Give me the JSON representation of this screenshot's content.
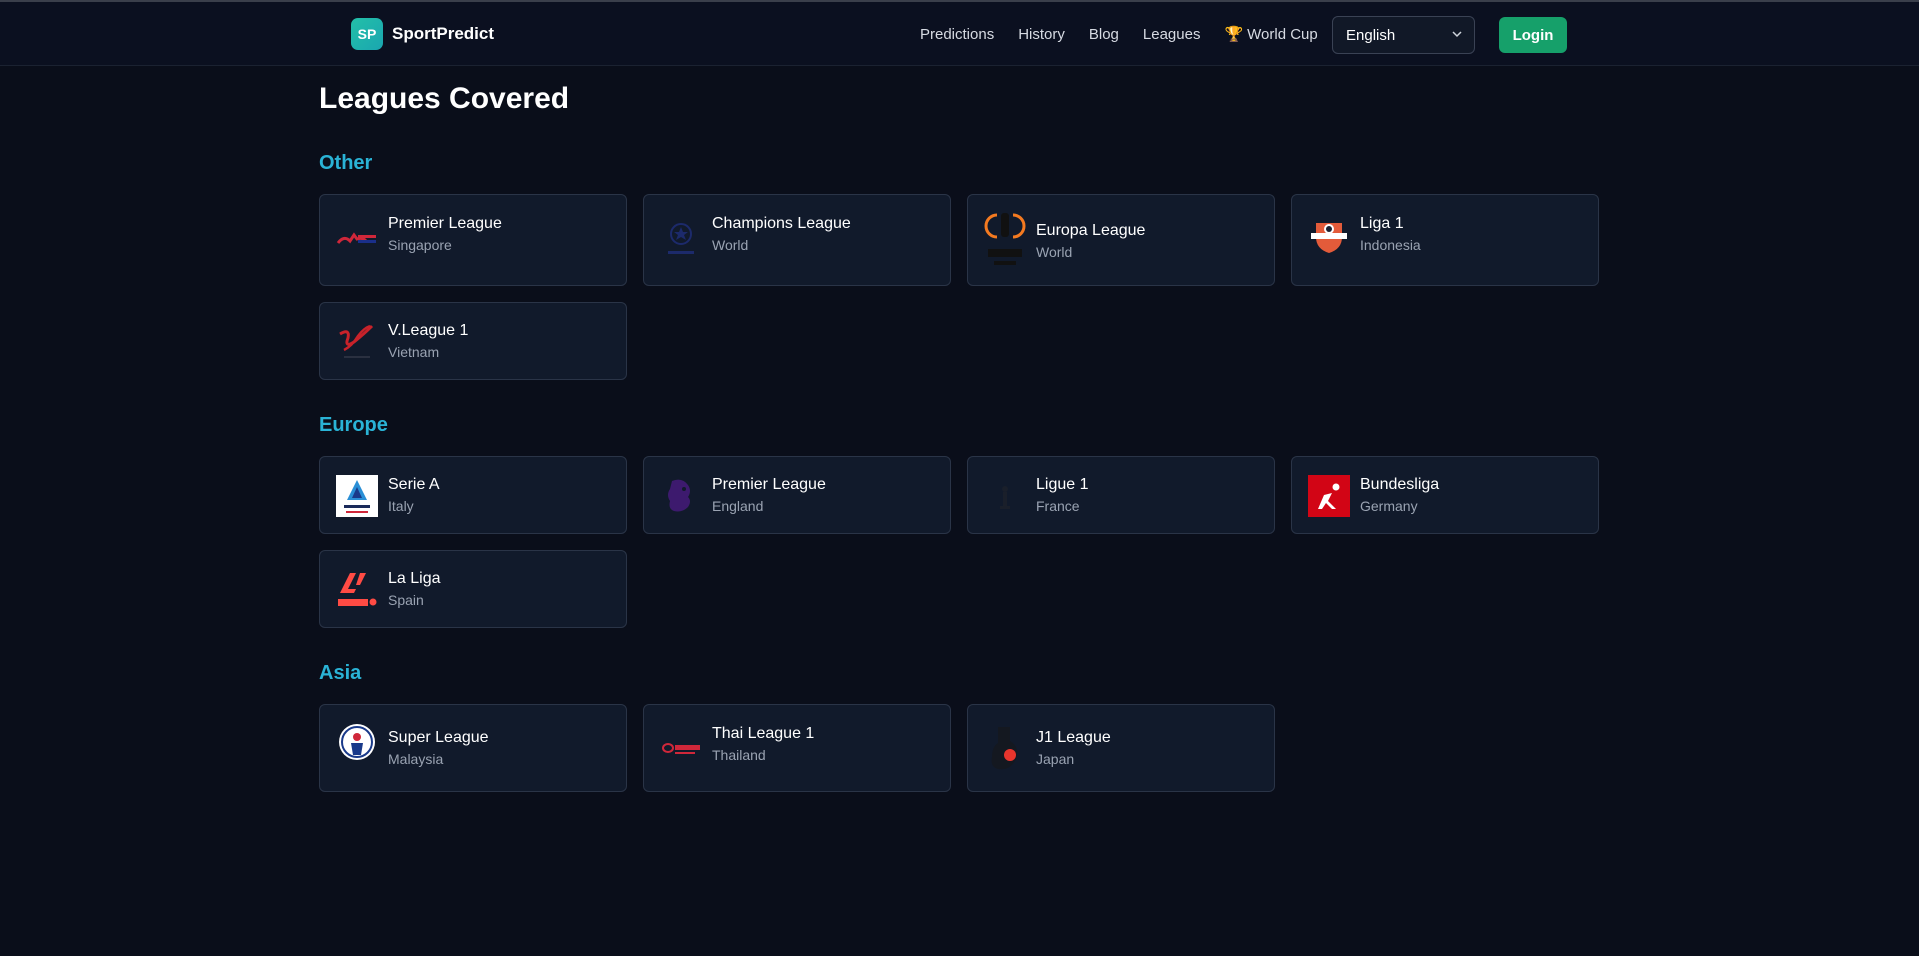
{
  "nav": {
    "brand_badge": "SP",
    "brand_name": "SportPredict",
    "links": [
      "Predictions",
      "History",
      "Blog",
      "Leagues",
      "World Cup"
    ],
    "language": "English",
    "login_label": "Login"
  },
  "page": {
    "title": "Leagues Covered"
  },
  "sections": [
    {
      "title": "Other",
      "leagues": [
        {
          "name": "Premier League",
          "country": "Singapore",
          "logo_icon": "singapore-premier-league-logo"
        },
        {
          "name": "Champions League",
          "country": "World",
          "logo_icon": "champions-league-logo"
        },
        {
          "name": "Europa League",
          "country": "World",
          "logo_icon": "europa-league-logo"
        },
        {
          "name": "Liga 1",
          "country": "Indonesia",
          "logo_icon": "liga-1-indonesia-logo"
        },
        {
          "name": "V.League 1",
          "country": "Vietnam",
          "logo_icon": "v-league-logo"
        }
      ]
    },
    {
      "title": "Europe",
      "leagues": [
        {
          "name": "Serie A",
          "country": "Italy",
          "logo_icon": "serie-a-logo"
        },
        {
          "name": "Premier League",
          "country": "England",
          "logo_icon": "premier-league-lion-logo"
        },
        {
          "name": "Ligue 1",
          "country": "France",
          "logo_icon": "ligue-1-logo"
        },
        {
          "name": "Bundesliga",
          "country": "Germany",
          "logo_icon": "bundesliga-logo"
        },
        {
          "name": "La Liga",
          "country": "Spain",
          "logo_icon": "la-liga-logo"
        }
      ]
    },
    {
      "title": "Asia",
      "leagues": [
        {
          "name": "Super League",
          "country": "Malaysia",
          "logo_icon": "malaysia-super-league-logo"
        },
        {
          "name": "Thai League 1",
          "country": "Thailand",
          "logo_icon": "thai-league-logo"
        },
        {
          "name": "J1 League",
          "country": "Japan",
          "logo_icon": "j1-league-logo"
        }
      ]
    }
  ],
  "colors": {
    "background": "#0a0e1a",
    "card": "#111a2b",
    "section_accent": "#2ab3d6",
    "login_button": "#16a06a",
    "brand_badge": "#23c0a8"
  }
}
